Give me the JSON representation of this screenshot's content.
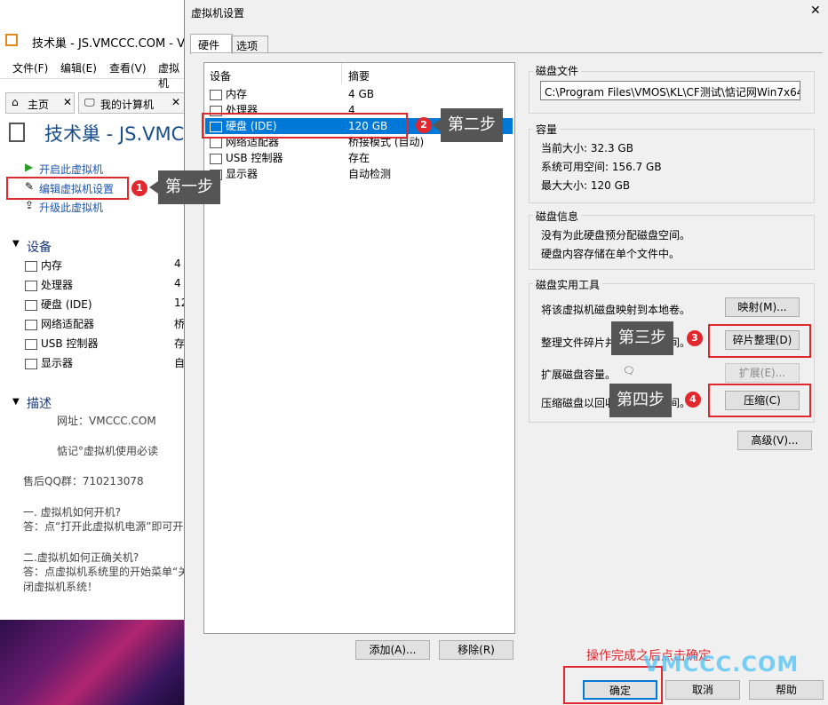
{
  "main": {
    "title": "技术巢 - JS.VMCCC.COM - VM",
    "menu": [
      "文件(F)",
      "编辑(E)",
      "查看(V)",
      "虚拟机"
    ],
    "tabs": [
      "主页",
      "我的计算机"
    ],
    "vm_title": "技术巢 - JS.VMC",
    "actions": [
      "开启此虚拟机",
      "编辑虚拟机设置",
      "升级此虚拟机"
    ],
    "devices_header": "设备",
    "devices": [
      {
        "name": "内存",
        "value": "4"
      },
      {
        "name": "处理器",
        "value": "4"
      },
      {
        "name": "硬盘 (IDE)",
        "value": "12"
      },
      {
        "name": "网络适配器",
        "value": "桥"
      },
      {
        "name": "USB 控制器",
        "value": "存"
      },
      {
        "name": "显示器",
        "value": "自"
      }
    ],
    "desc_header": "描述",
    "desc_lines": [
      "网址：VMCCC.COM",
      "惦记°虚拟机使用必读",
      "售后QQ群：710213078",
      "一. 虚拟机如何开机?",
      "答：点“打开此虚拟机电源”即可开",
      "二.虚拟机如何正确关机?",
      "答：点虚拟机系统里的开始菜单“关",
      "闭虚拟机系统！"
    ]
  },
  "dialog": {
    "title": "虚拟机设置",
    "close": "✕",
    "tabs": [
      "硬件",
      "选项"
    ],
    "list_headers": [
      "设备",
      "摘要"
    ],
    "list": [
      {
        "name": "内存",
        "summary": "4 GB"
      },
      {
        "name": "处理器",
        "summary": "4"
      },
      {
        "name": "硬盘 (IDE)",
        "summary": "120 GB"
      },
      {
        "name": "网络适配器",
        "summary": "桥接模式 (自动)"
      },
      {
        "name": "USB 控制器",
        "summary": "存在"
      },
      {
        "name": "显示器",
        "summary": "自动检测"
      }
    ],
    "add_button": "添加(A)...",
    "remove_button": "移除(R)",
    "disk_file": {
      "title": "磁盘文件",
      "value": "C:\\Program Files\\VMOS\\KL\\CF测试\\惦记网Win7x64旗"
    },
    "capacity": {
      "title": "容量",
      "current": "当前大小: 32.3 GB",
      "available": "系统可用空间: 156.7 GB",
      "max": "最大大小: 120 GB"
    },
    "disk_info": {
      "title": "磁盘信息",
      "line1": "没有为此硬盘预分配磁盘空间。",
      "line2": "硬盘内容存储在单个文件中。"
    },
    "utilities": {
      "title": "磁盘实用工具",
      "map_text": "将该虚拟机磁盘映射到本地卷。",
      "map_button": "映射(M)...",
      "defrag_text": "整理文件碎片并合并可用空间。",
      "defrag_button": "碎片整理(D)",
      "expand_text": "扩展磁盘容量。",
      "expand_button": "扩展(E)...",
      "compact_text": "压缩磁盘以回收未使用的空间。",
      "compact_button": "压缩(C)"
    },
    "advanced_button": "高级(V)...",
    "ok_button": "确定",
    "cancel_button": "取消",
    "help_button": "帮助"
  },
  "annotations": {
    "step1": "第一步",
    "step2": "第二步",
    "step3": "第三步",
    "step4": "第四步",
    "n1": "1",
    "n2": "2",
    "n3": "3",
    "n4": "4",
    "final_note": "操作完成之后点击确定",
    "watermark": "VMCCC.COM"
  },
  "colors": {
    "annotation_red": "#e0282e",
    "selection": "#0078d7",
    "callout": "#555555",
    "watermark": "#4fc3f7"
  }
}
